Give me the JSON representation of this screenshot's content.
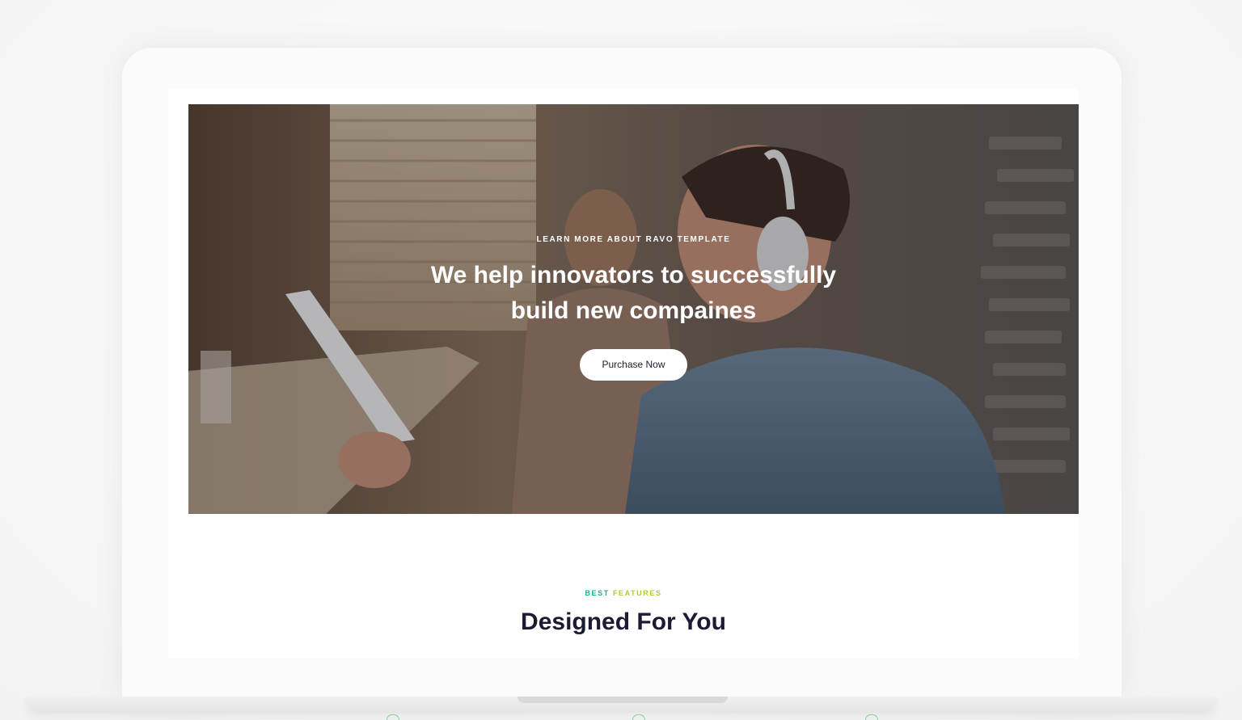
{
  "hero": {
    "eyebrow": "LEARN MORE ABOUT RAVO TEMPLATE",
    "title": "We help innovators to successfully build new compaines",
    "button_label": "Purchase Now"
  },
  "features": {
    "eyebrow_word1": "BEST",
    "eyebrow_word2": "FEATURES",
    "title": "Designed For You"
  },
  "colors": {
    "accent_green": "#17b388",
    "accent_lime": "#a9cc3c",
    "heading_dark": "#1b1b33"
  }
}
